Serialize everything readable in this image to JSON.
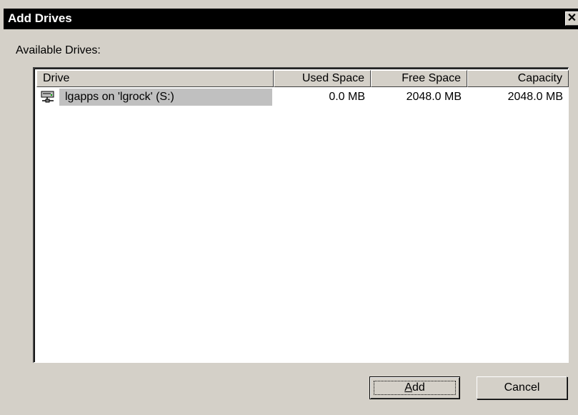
{
  "window": {
    "title": "Add Drives",
    "close_label": "✕"
  },
  "section": {
    "label": "Available Drives:"
  },
  "list": {
    "columns": [
      {
        "label": "Drive"
      },
      {
        "label": "Used Space"
      },
      {
        "label": "Free Space"
      },
      {
        "label": "Capacity"
      }
    ],
    "rows": [
      {
        "icon": "network-drive-icon",
        "drive": "lgapps on 'lgrock' (S:)",
        "used_space": "0.0 MB",
        "free_space": "2048.0 MB",
        "capacity": "2048.0 MB",
        "selected": true
      }
    ]
  },
  "buttons": {
    "add_label_prefix": "",
    "add_label_accel": "A",
    "add_label_rest": "dd",
    "cancel_label": "Cancel"
  }
}
